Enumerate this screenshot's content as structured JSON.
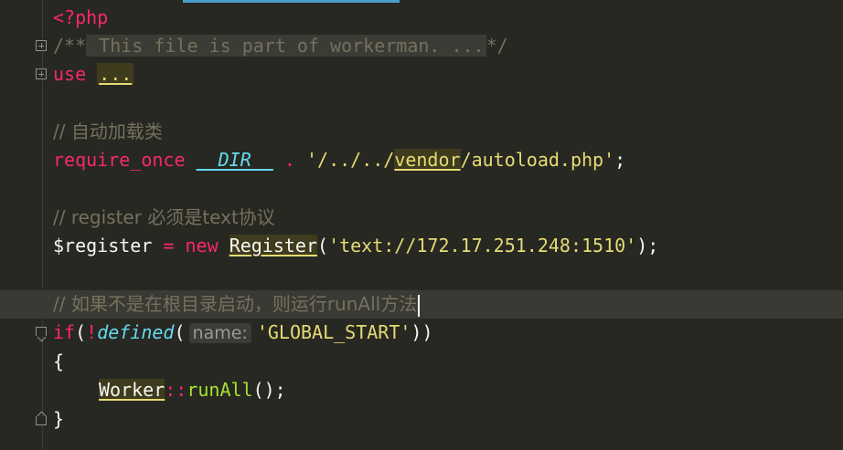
{
  "editor": {
    "lines": {
      "php_open": "<?php",
      "doc_open": "/**",
      "doc_fold": " This file is part of workerman. ...",
      "doc_close": "*/",
      "use_kw": "use",
      "use_fold": "...",
      "comment_autoload": "// 自动加载类",
      "require_kw": "require_once",
      "dir_const": "__DIR__",
      "dot_op": ".",
      "path_pre": "'/../../",
      "path_vendor": "vendor",
      "path_post": "/autoload.php'",
      "semicolon": ";",
      "comment_register": "// register 必须是text协议",
      "register_var": "$register",
      "assign_op": "=",
      "new_kw": "new",
      "register_class": "Register",
      "paren_open": "(",
      "register_arg": "'text://172.17.251.248:1510'",
      "paren_close_semi": ");",
      "comment_runall": "// 如果不是在根目录启动，则运行runAll方法",
      "if_kw": "if",
      "not_op": "!",
      "defined_fn": "defined",
      "hint_name": "name:",
      "global_start": "'GLOBAL_START'",
      "if_close": "))",
      "brace_open": "{",
      "worker_class": "Worker",
      "scope_op": "::",
      "runall_fn": "runAll",
      "call_end": "();",
      "brace_close": "}"
    }
  },
  "colors": {
    "background": "#272822",
    "keyword": "#f92672",
    "comment": "#75715e",
    "string": "#e6db74",
    "function": "#66d9ef",
    "constant": "#a6e22e",
    "tab_indicator": "#4a9ec9"
  },
  "icons": [
    "fold-collapsed-icon",
    "fold-start-icon",
    "fold-end-icon"
  ]
}
